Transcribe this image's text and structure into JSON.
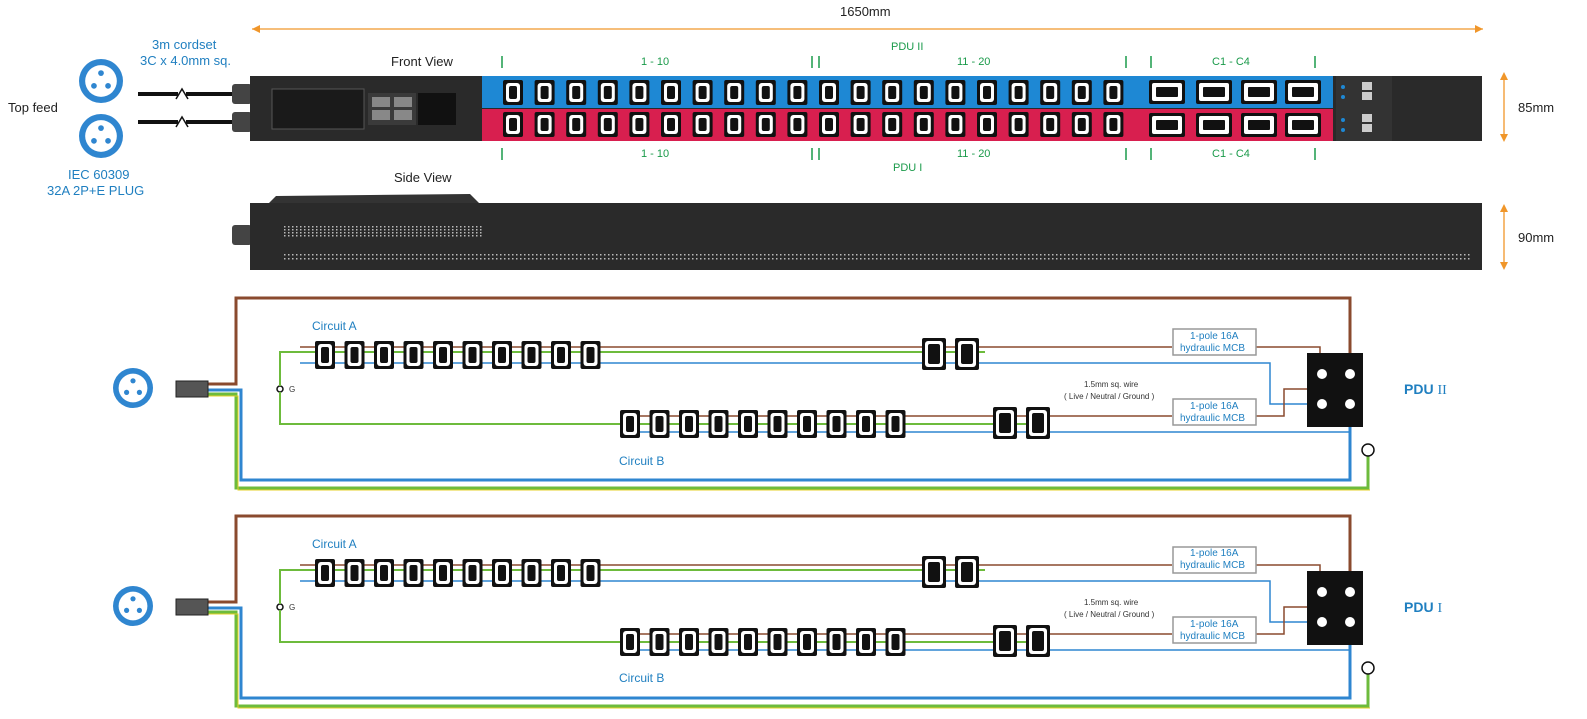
{
  "dimensions": {
    "length": "1650mm",
    "height_front": "85mm",
    "height_side": "90mm"
  },
  "feed": {
    "cordset_line1": "3m cordset",
    "cordset_line2": "3C x 4.0mm sq.",
    "top_feed": "Top feed",
    "plug_line1": "IEC 60309",
    "plug_line2": "32A 2P+E PLUG"
  },
  "views": {
    "front": "Front View",
    "side": "Side View"
  },
  "front_panel": {
    "pdu_top": "PDU II",
    "pdu_bottom": "PDU I",
    "top_groups": [
      "1 - 10",
      "11 - 20",
      "C1 - C4"
    ],
    "bottom_groups": [
      "1 - 10",
      "11 - 20",
      "C1 - C4"
    ],
    "top_strip_color": "#1e88d4",
    "bottom_strip_color": "#d81f4f"
  },
  "schematics": [
    {
      "circuit_a": "Circuit A",
      "circuit_b": "Circuit B",
      "ground": "G",
      "wire_line1": "1.5mm sq. wire",
      "wire_line2": "( Live / Neutral / Ground )",
      "mcb_a_line1": "1-pole 16A",
      "mcb_a_line2": "hydraulic MCB",
      "mcb_b_line1": "1-pole 16A",
      "mcb_b_line2": "hydraulic MCB",
      "pdu_label": "PDU",
      "pdu_numeral": "II"
    },
    {
      "circuit_a": "Circuit A",
      "circuit_b": "Circuit B",
      "ground": "G",
      "wire_line1": "1.5mm sq. wire",
      "wire_line2": "( Live / Neutral / Ground )",
      "mcb_a_line1": "1-pole 16A",
      "mcb_a_line2": "hydraulic MCB",
      "mcb_b_line1": "1-pole 16A",
      "mcb_b_line2": "hydraulic MCB",
      "pdu_label": "PDU",
      "pdu_numeral": "I"
    }
  ],
  "colors": {
    "live": "#8a4a2e",
    "neutral": "#2f86d0",
    "ground": "#6dbb3c",
    "accent_orange": "#f0962a",
    "text_blue": "#1f7fc0",
    "text_green": "#1a9a4a"
  }
}
